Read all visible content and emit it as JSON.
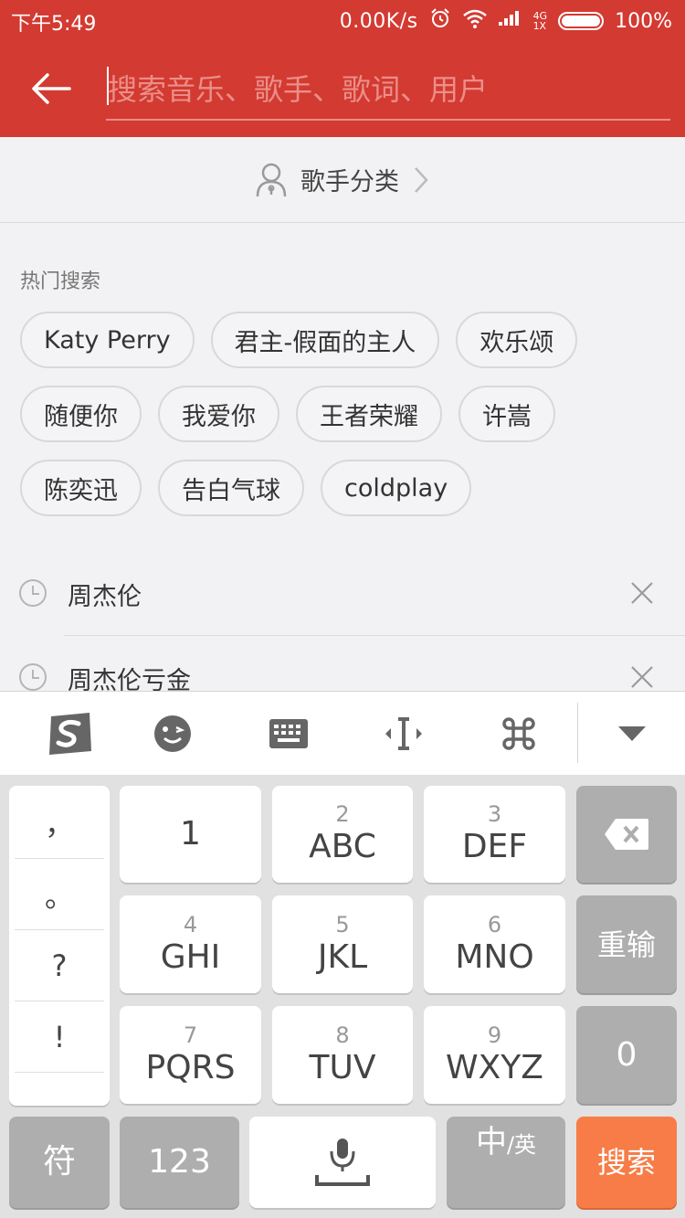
{
  "status_bar": {
    "time": "下午5:49",
    "net_speed": "0.00K/s",
    "signal_top": "4G",
    "signal_bottom": "1X",
    "battery": "100%"
  },
  "search": {
    "placeholder": "搜索音乐、歌手、歌词、用户",
    "value": ""
  },
  "singer_category": {
    "label": "歌手分类"
  },
  "hot": {
    "title": "热门搜索",
    "tags": [
      "Katy Perry",
      "君主-假面的主人",
      "欢乐颂",
      "随便你",
      "我爱你",
      "王者荣耀",
      "许嵩",
      "陈奕迅",
      "告白气球",
      "coldplay"
    ]
  },
  "history": [
    "周杰伦",
    "周杰伦亏金"
  ],
  "keyboard": {
    "punctuation": [
      "，",
      "。",
      "?",
      "!"
    ],
    "keys": [
      {
        "num": "",
        "main": "1"
      },
      {
        "num": "2",
        "main": "ABC"
      },
      {
        "num": "3",
        "main": "DEF"
      },
      {
        "num": "4",
        "main": "GHI"
      },
      {
        "num": "5",
        "main": "JKL"
      },
      {
        "num": "6",
        "main": "MNO"
      },
      {
        "num": "7",
        "main": "PQRS"
      },
      {
        "num": "8",
        "main": "TUV"
      },
      {
        "num": "9",
        "main": "WXYZ"
      }
    ],
    "reinput": "重输",
    "zero": "0",
    "symbols": "符",
    "numbers": "123",
    "lang_main": "中",
    "lang_alt": "/英",
    "search": "搜索"
  },
  "colors": {
    "brand_red": "#d33a31",
    "search_orange": "#f77c47"
  }
}
